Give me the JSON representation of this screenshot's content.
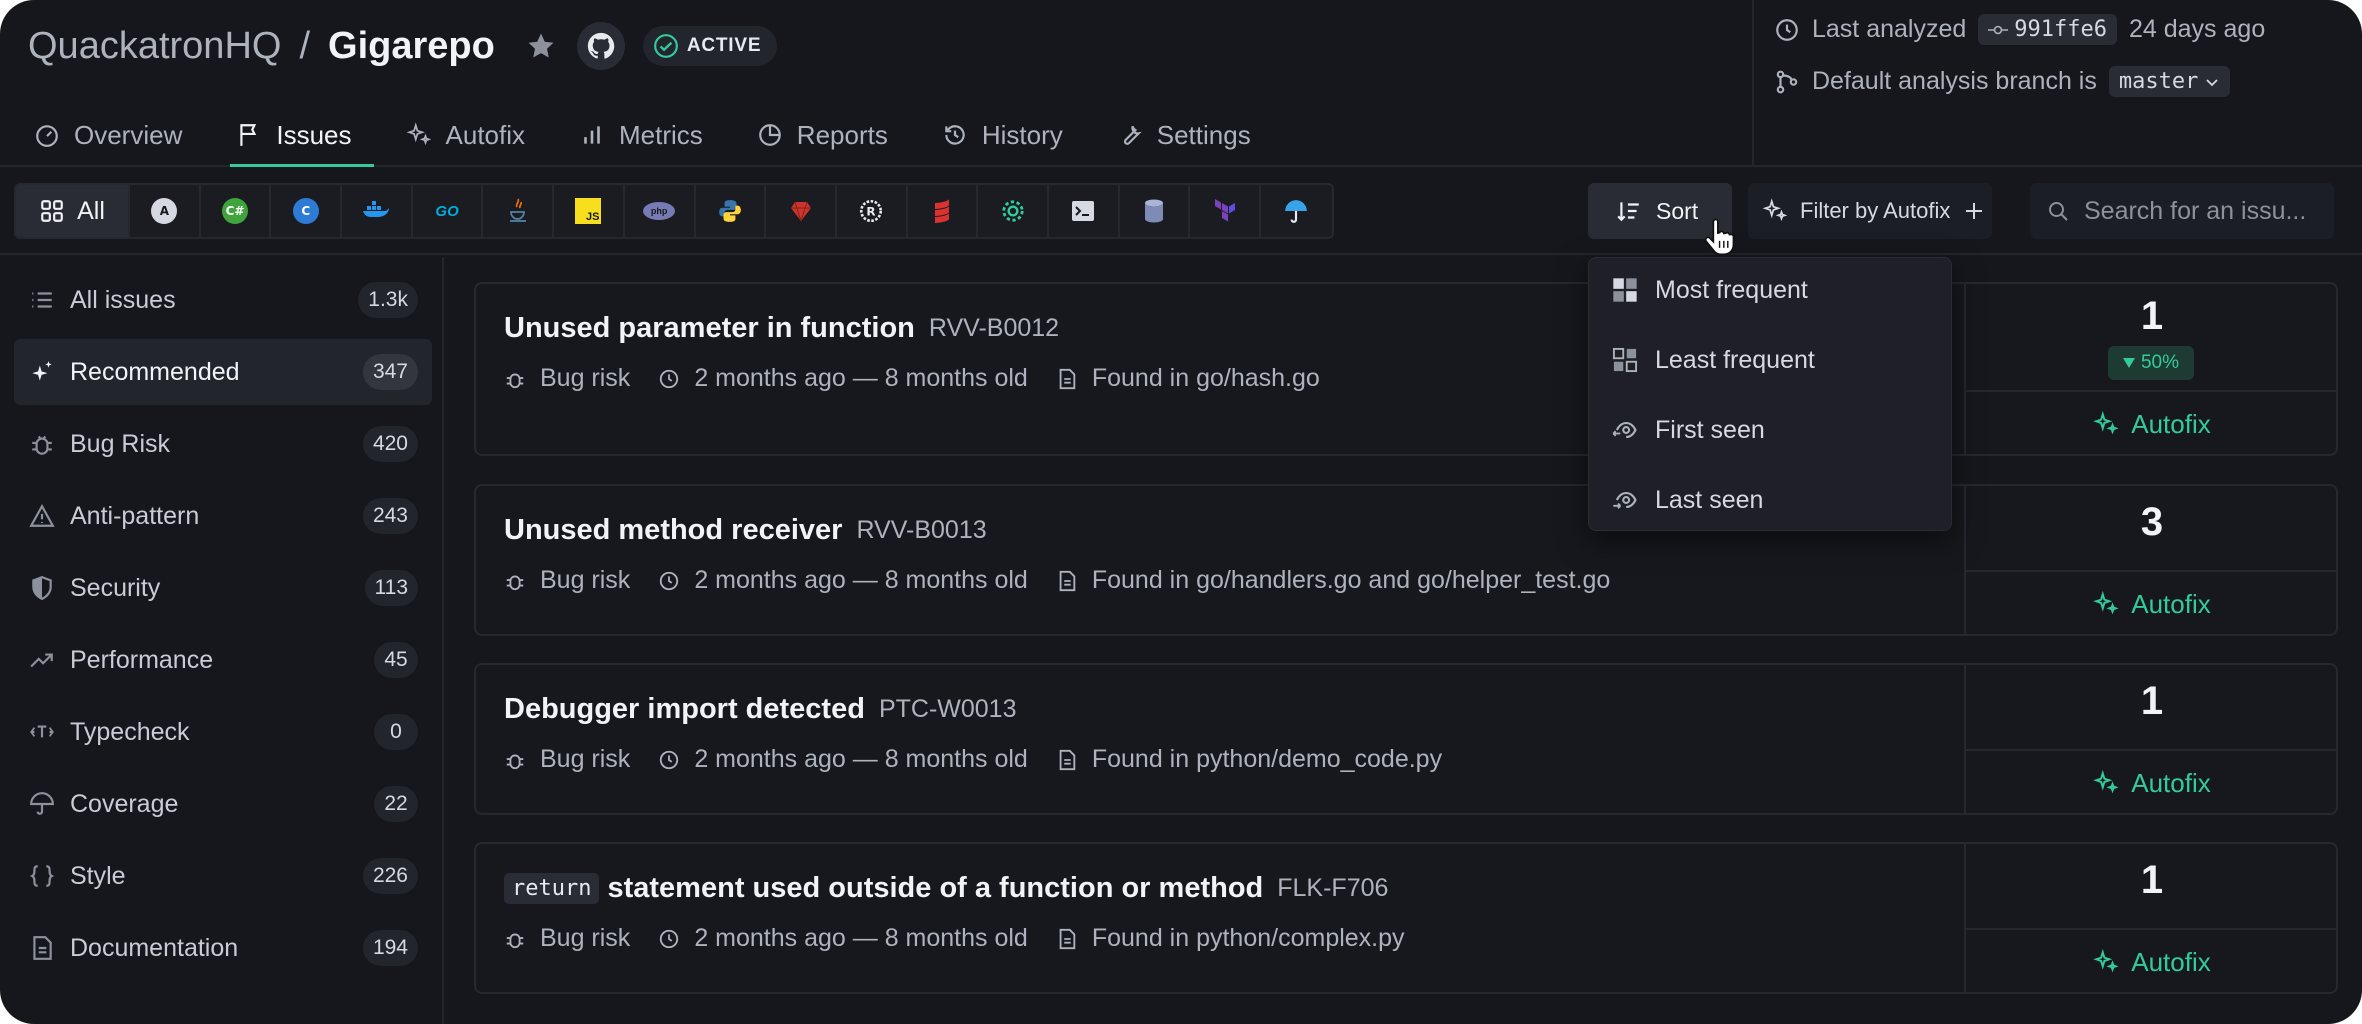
{
  "repo": {
    "org": "QuackatronHQ",
    "separator": "/",
    "name": "Gigarepo",
    "status": "ACTIVE"
  },
  "analysis": {
    "last_analyzed_label": "Last analyzed",
    "commit": "991ffe6",
    "ago": "24 days ago",
    "branch_label": "Default analysis branch is",
    "branch": "master"
  },
  "tabs": [
    {
      "label": "Overview",
      "icon": "gauge-icon"
    },
    {
      "label": "Issues",
      "icon": "flag-icon"
    },
    {
      "label": "Autofix",
      "icon": "sparkle-icon"
    },
    {
      "label": "Metrics",
      "icon": "bar-chart-icon"
    },
    {
      "label": "Reports",
      "icon": "pie-chart-icon"
    },
    {
      "label": "History",
      "icon": "history-icon"
    },
    {
      "label": "Settings",
      "icon": "wrench-icon"
    }
  ],
  "toolbar": {
    "all_label": "All",
    "sort_label": "Sort",
    "filter_label": "Filter by Autofix",
    "search_placeholder": "Search for an issu..."
  },
  "languages": [
    "ansible",
    "csharp",
    "cxx",
    "docker",
    "go",
    "java",
    "javascript",
    "php",
    "python",
    "ruby",
    "rust",
    "scala",
    "kotlin",
    "shell",
    "sql",
    "terraform",
    "test-coverage"
  ],
  "sidebar": [
    {
      "label": "All issues",
      "count": "1.3k",
      "icon": "list-icon"
    },
    {
      "label": "Recommended",
      "count": "347",
      "icon": "sparkles-icon"
    },
    {
      "label": "Bug Risk",
      "count": "420",
      "icon": "bug-icon"
    },
    {
      "label": "Anti-pattern",
      "count": "243",
      "icon": "warning-icon"
    },
    {
      "label": "Security",
      "count": "113",
      "icon": "shield-icon"
    },
    {
      "label": "Performance",
      "count": "45",
      "icon": "trend-up-icon"
    },
    {
      "label": "Typecheck",
      "count": "0",
      "icon": "type-icon"
    },
    {
      "label": "Coverage",
      "count": "22",
      "icon": "umbrella-icon"
    },
    {
      "label": "Style",
      "count": "226",
      "icon": "braces-icon"
    },
    {
      "label": "Documentation",
      "count": "194",
      "icon": "document-icon"
    }
  ],
  "issues": [
    {
      "title": "Unused parameter in function",
      "code": "RVV-B0012",
      "category": "Bug risk",
      "age": "2 months ago — 8 months old",
      "found": "Found in go/hash.go",
      "occurrences": "1",
      "trend": "50%",
      "autofix": "Autofix"
    },
    {
      "title": "Unused method receiver",
      "code": "RVV-B0013",
      "category": "Bug risk",
      "age": "2 months ago — 8 months old",
      "found": "Found in go/handlers.go and go/helper_test.go",
      "occurrences": "3",
      "autofix": "Autofix"
    },
    {
      "title": "Debugger import detected",
      "code": "PTC-W0013",
      "category": "Bug risk",
      "age": "2 months ago — 8 months old",
      "found": "Found in python/demo_code.py",
      "occurrences": "1",
      "autofix": "Autofix"
    },
    {
      "keyword": "return",
      "title": "statement used outside of a function or method",
      "code": "FLK-F706",
      "category": "Bug risk",
      "age": "2 months ago — 8 months old",
      "found": "Found in python/complex.py",
      "occurrences": "1",
      "autofix": "Autofix"
    }
  ],
  "sort_menu": [
    {
      "label": "Most frequent",
      "icon": "grid-filled-icon"
    },
    {
      "label": "Least frequent",
      "icon": "grid-outline-icon"
    },
    {
      "label": "First seen",
      "icon": "eye-back-icon"
    },
    {
      "label": "Last seen",
      "icon": "eye-forward-icon"
    }
  ],
  "colors": {
    "background": "#16171c",
    "accent": "#33cb9a",
    "text": "#c9ccd6"
  }
}
